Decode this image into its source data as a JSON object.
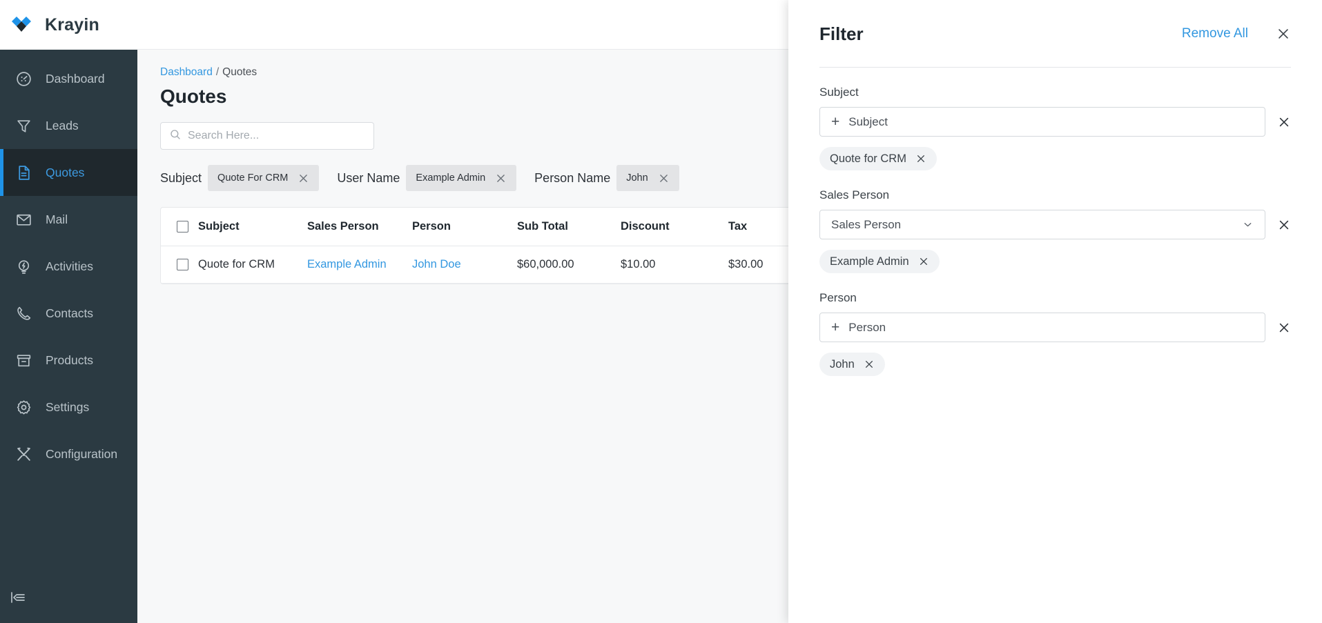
{
  "brand": {
    "name": "Krayin"
  },
  "sidebar": {
    "items": [
      {
        "label": "Dashboard",
        "icon": "dashboard-icon",
        "active": false
      },
      {
        "label": "Leads",
        "icon": "funnel-icon",
        "active": false
      },
      {
        "label": "Quotes",
        "icon": "document-icon",
        "active": true
      },
      {
        "label": "Mail",
        "icon": "envelope-icon",
        "active": false
      },
      {
        "label": "Activities",
        "icon": "lightbulb-icon",
        "active": false
      },
      {
        "label": "Contacts",
        "icon": "phone-icon",
        "active": false
      },
      {
        "label": "Products",
        "icon": "box-icon",
        "active": false
      },
      {
        "label": "Settings",
        "icon": "gear-icon",
        "active": false
      },
      {
        "label": "Configuration",
        "icon": "tools-icon",
        "active": false
      }
    ],
    "collapse_icon": "collapse-sidebar-icon"
  },
  "breadcrumb": {
    "root": "Dashboard",
    "separator": "/",
    "current": "Quotes"
  },
  "page": {
    "title": "Quotes"
  },
  "search": {
    "value": "",
    "placeholder": "Search Here...",
    "icon": "search-icon"
  },
  "active_filters": [
    {
      "label": "Subject",
      "value": "Quote For CRM"
    },
    {
      "label": "User Name",
      "value": "Example Admin"
    },
    {
      "label": "Person Name",
      "value": "John"
    }
  ],
  "table": {
    "columns": [
      "Subject",
      "Sales Person",
      "Person",
      "Sub Total",
      "Discount",
      "Tax"
    ],
    "rows": [
      {
        "subject": "Quote for CRM",
        "sales_person": "Example Admin",
        "person": "John Doe",
        "sub_total": "$60,000.00",
        "discount": "$10.00",
        "tax": "$30.00"
      }
    ]
  },
  "filter_panel": {
    "title": "Filter",
    "remove_all": "Remove All",
    "close_icon": "close-icon",
    "groups": [
      {
        "label": "Subject",
        "field_type": "add",
        "field_text": "Subject",
        "tags": [
          "Quote for CRM"
        ]
      },
      {
        "label": "Sales Person",
        "field_type": "select",
        "field_text": "Sales Person",
        "tags": [
          "Example Admin"
        ]
      },
      {
        "label": "Person",
        "field_type": "add",
        "field_text": "Person",
        "tags": [
          "John"
        ]
      }
    ]
  },
  "colors": {
    "accent": "#1f93e8",
    "link": "#3297e0",
    "sidebar_bg": "#2b3a42",
    "sidebar_active_bg": "#1f282d",
    "page_bg": "#f7f8f9"
  }
}
